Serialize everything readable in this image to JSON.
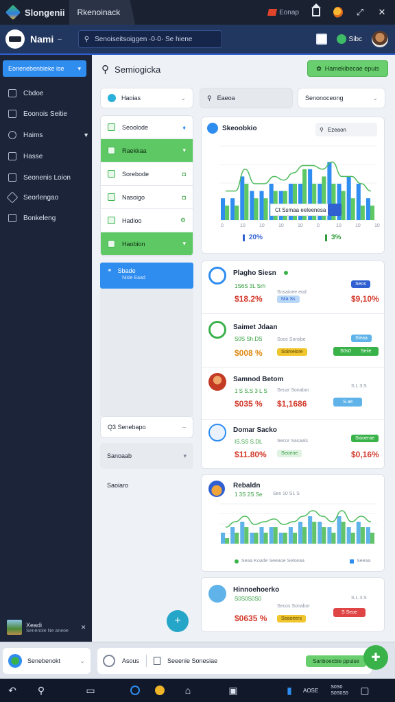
{
  "titlebar": {
    "app_name": "Slongenii",
    "tab_label": "Rkenoinack",
    "flag_label": "Eonap"
  },
  "header": {
    "title": "Nami",
    "search_placeholder": "Senoiseitsoiggen  ·0·0· Se hiene",
    "user_label": "Sibc"
  },
  "sidebar": {
    "cta_label": "Eonenebenbieke ise",
    "items": [
      {
        "label": "Cbdoe",
        "icon": "grid-icon"
      },
      {
        "label": "Eoonois Seitie",
        "icon": "document-icon"
      },
      {
        "label": "Haims",
        "icon": "share-icon"
      },
      {
        "label": "Hasse",
        "icon": "page-icon"
      },
      {
        "label": "Seonenis Loion",
        "icon": "folder-icon"
      },
      {
        "label": "Seorlengao",
        "icon": "tag-icon"
      },
      {
        "label": "Bonkeleng",
        "icon": "card-icon"
      }
    ],
    "footer": {
      "name": "Xeadi",
      "sub": "Senenoie Ne aneoe"
    }
  },
  "main": {
    "search_label": "Semiogicka",
    "green_button": "Hamekibecae epuis",
    "dropdown_1": "Haoias",
    "dropdown_2": "Eaeoa",
    "dropdown_3": "Senonoceong",
    "list": [
      {
        "label": "Seoolode",
        "end": "",
        "active": false
      },
      {
        "label": "Raekkaa",
        "end": "▾",
        "active": true
      },
      {
        "label": "Sorebode",
        "end": "",
        "active": false
      },
      {
        "label": "Nasoigo",
        "end": "",
        "active": false
      },
      {
        "label": "Hadioo",
        "end": "",
        "active": false
      },
      {
        "label": "Haobion",
        "end": "▾",
        "active": true
      }
    ],
    "blue_card": {
      "title": "Sbade",
      "sub": "Nisle Eaad"
    },
    "lower_list": [
      {
        "label": "Q3 Senebapo",
        "end": "–"
      },
      {
        "label": "Sanoaab",
        "end": "▾"
      },
      {
        "label": "Saoiaro",
        "end": ""
      }
    ]
  },
  "chart1": {
    "title": "Skeoobkio",
    "search": "Ezeaon",
    "tooltip": "Ct Ssmaa  eeleenesa",
    "stat_a": "20%",
    "stat_b": "3%",
    "x_ticks": [
      "0",
      "10",
      "10",
      "10",
      "10",
      "0",
      "10",
      "10",
      "10"
    ]
  },
  "items": [
    {
      "name": "Plagho Siesn",
      "sub1": "1S6S 3L Srh",
      "sub2": "Sosaioee  eod",
      "badge": "Seos",
      "val_left": "$18.2%",
      "val_right": "$9,10%",
      "left_pill": "Nia Ss",
      "right_pill": ""
    },
    {
      "name": "Saimet Jdaan",
      "sub1": "S0S Sh.DS",
      "sub2": "Soce Sonsbe",
      "badge": "Sleaa",
      "val_left": "$008 %",
      "val_right": "S0s0",
      "left_pill": "Soimeiore",
      "right_pill": "Seiie"
    },
    {
      "name": "Samnod Betom",
      "sub1": "1 S S.S 3 L S",
      "sub2": "Secar Sonabor",
      "badge": "S.L 3.S",
      "val_left": "$035 %",
      "val_right": "$1,1686",
      "left_pill": "",
      "right_pill": "S.ae"
    },
    {
      "name": "Domar Sacko",
      "sub1": "IS.SS S.DL",
      "sub2": "Secor Sasaals",
      "badge": "Siooerae",
      "val_left": "$11.80%",
      "val_right": "$0,16%",
      "left_pill": "Seoene",
      "right_pill": ""
    },
    {
      "name": "Hinnoehoerko",
      "sub1": "S0S0S0S0",
      "sub2": "Secos Sonabor",
      "badge": "S.L 3.S",
      "val_left": "$0635 %",
      "val_right": "",
      "left_pill": "Seaoeers",
      "right_pill": "S Seoe"
    }
  ],
  "chart2": {
    "title": "Rebaldn",
    "sub1": "1 3S 2S Se",
    "sub2": "Ses 10 S1 S",
    "legend_a": "Seaa Koade Seeaoe Selseaa",
    "legend_b": "Seeaa"
  },
  "bottom": {
    "left_label": "Senebenokt",
    "mid_a": "Asous",
    "mid_b": "Seeenie Sonesiae",
    "right_label": "Sanboecbie ppuise"
  },
  "taskbar": {
    "right_a": "AOSE",
    "right_b": "S0S0",
    "right_c": "S0S0S5"
  },
  "chart_data": [
    {
      "type": "bar",
      "series": [
        {
          "name": "",
          "values": [
            3,
            3,
            6,
            4,
            4,
            5,
            4,
            5,
            5,
            7,
            5,
            8,
            5,
            6,
            5,
            3
          ],
          "color": "#2f8df0"
        },
        {
          "name": "",
          "values": [
            2,
            2,
            5,
            3,
            3,
            4,
            4,
            5,
            7,
            5,
            6,
            5,
            4,
            3,
            2,
            2
          ],
          "color": "#5ec964"
        }
      ]
    },
    {
      "type": "bar",
      "series": [
        {
          "name": "",
          "values": [
            2,
            3,
            4,
            2,
            3,
            3,
            2,
            3,
            4,
            5,
            4,
            3,
            5,
            3,
            4,
            3
          ],
          "color": "#5fb3e8"
        },
        {
          "name": "",
          "values": [
            1,
            2,
            3,
            2,
            2,
            3,
            2,
            2,
            3,
            4,
            3,
            2,
            4,
            2,
            3,
            2
          ],
          "color": "#62c46a"
        }
      ]
    }
  ]
}
